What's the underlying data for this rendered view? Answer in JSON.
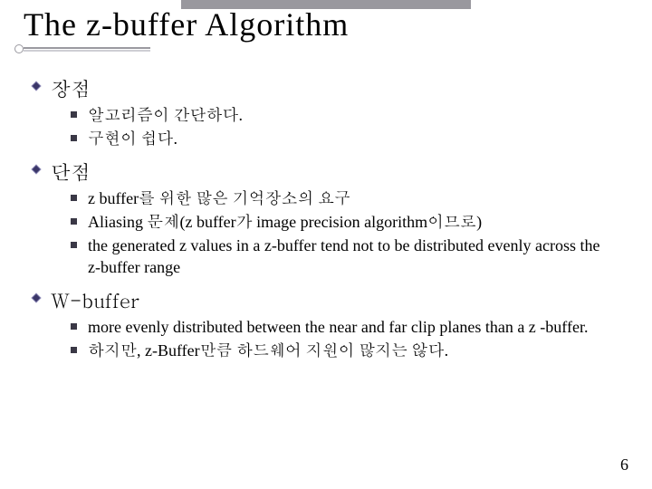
{
  "title": "The z-buffer Algorithm",
  "sections": [
    {
      "heading": "장점",
      "items": [
        "알고리즘이 간단하다.",
        "구현이 쉽다."
      ]
    },
    {
      "heading": "단점",
      "items": [
        "z buffer를 위한 많은 기억장소의 요구",
        "Aliasing 문제(z buffer가 image precision algorithm이므로)",
        "the generated z values in a z-buffer tend not to be distributed evenly across the z-buffer range"
      ]
    },
    {
      "heading": "W-buffer",
      "items": [
        "more evenly distributed between the near and far clip planes than a z -buffer.",
        "하지만, z-Buffer만큼 하드웨어 지원이 많지는 않다."
      ]
    }
  ],
  "page_number": "6"
}
